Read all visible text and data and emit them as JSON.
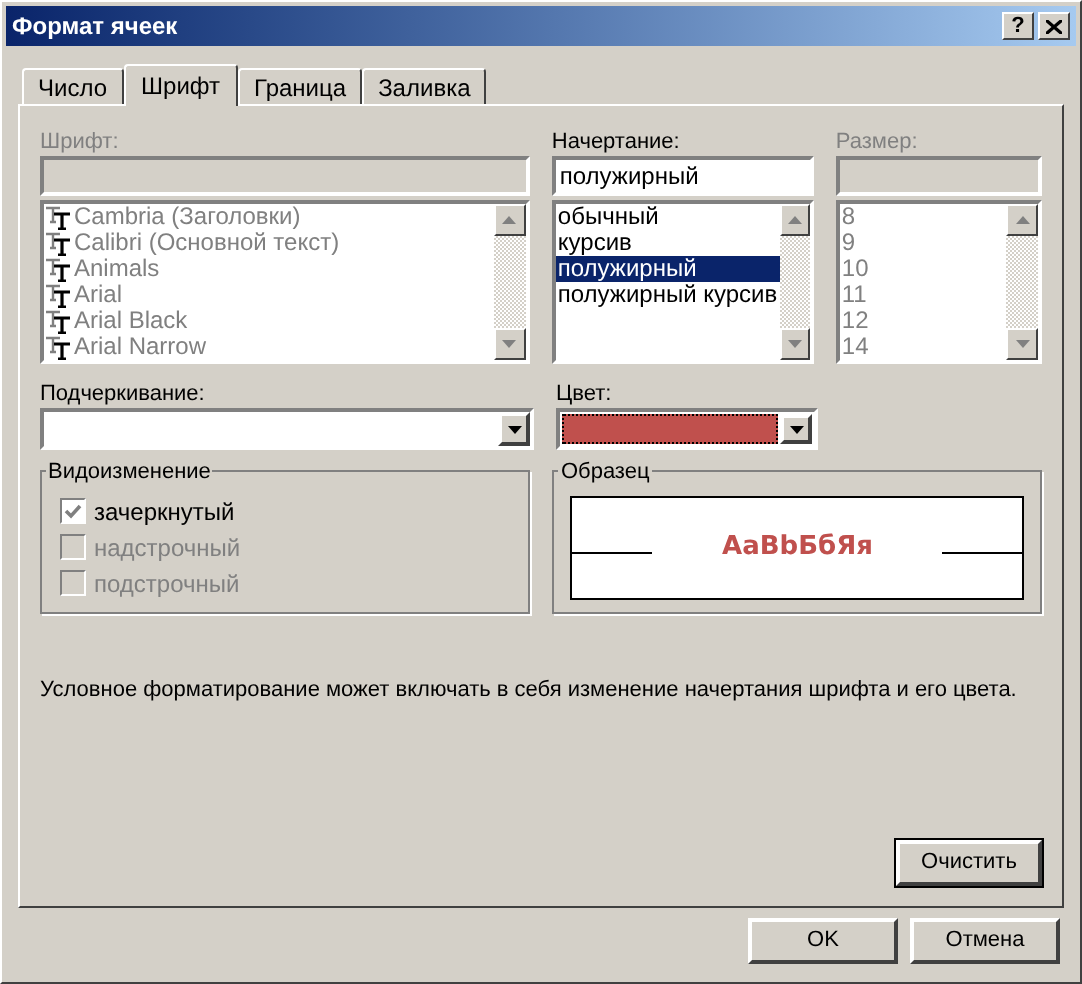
{
  "window": {
    "title": "Формат ячеек",
    "help": "?"
  },
  "tabs": [
    {
      "label": "Число",
      "selected": false
    },
    {
      "label": "Шрифт",
      "selected": true
    },
    {
      "label": "Граница",
      "selected": false
    },
    {
      "label": "Заливка",
      "selected": false
    }
  ],
  "font": {
    "label": "Шрифт:",
    "disabled": true,
    "items": [
      {
        "text": "Cambria (Заголовки)"
      },
      {
        "text": "Calibri (Основной текст)"
      },
      {
        "text": "Animals"
      },
      {
        "text": "Arial"
      },
      {
        "text": "Arial Black"
      },
      {
        "text": "Arial Narrow"
      }
    ]
  },
  "style": {
    "label": "Начертание:",
    "disabled": false,
    "value": "полужирный",
    "items": [
      {
        "text": "обычный",
        "selected": false
      },
      {
        "text": "курсив",
        "selected": false
      },
      {
        "text": "полужирный",
        "selected": true
      },
      {
        "text": "полужирный курсив",
        "selected": false
      }
    ]
  },
  "size": {
    "label": "Размер:",
    "disabled": true,
    "items": [
      {
        "text": "8"
      },
      {
        "text": "9"
      },
      {
        "text": "10"
      },
      {
        "text": "11"
      },
      {
        "text": "12"
      },
      {
        "text": "14"
      }
    ]
  },
  "underline": {
    "label": "Подчеркивание:"
  },
  "color": {
    "label": "Цвет:",
    "color": "#c0504d"
  },
  "effects": {
    "title": "Видоизменение",
    "options": [
      {
        "label": "зачеркнутый",
        "checked": true,
        "disabled": false
      },
      {
        "label": "надстрочный",
        "checked": false,
        "disabled": true
      },
      {
        "label": "подстрочный",
        "checked": false,
        "disabled": true
      }
    ]
  },
  "preview": {
    "title": "Образец",
    "sample": "AaBbБбЯя"
  },
  "note": "Условное форматирование может включать в себя изменение начертания шрифта и его цвета.",
  "clear_button": "Очистить",
  "buttons": [
    {
      "label": "OK"
    },
    {
      "label": "Отмена"
    }
  ]
}
